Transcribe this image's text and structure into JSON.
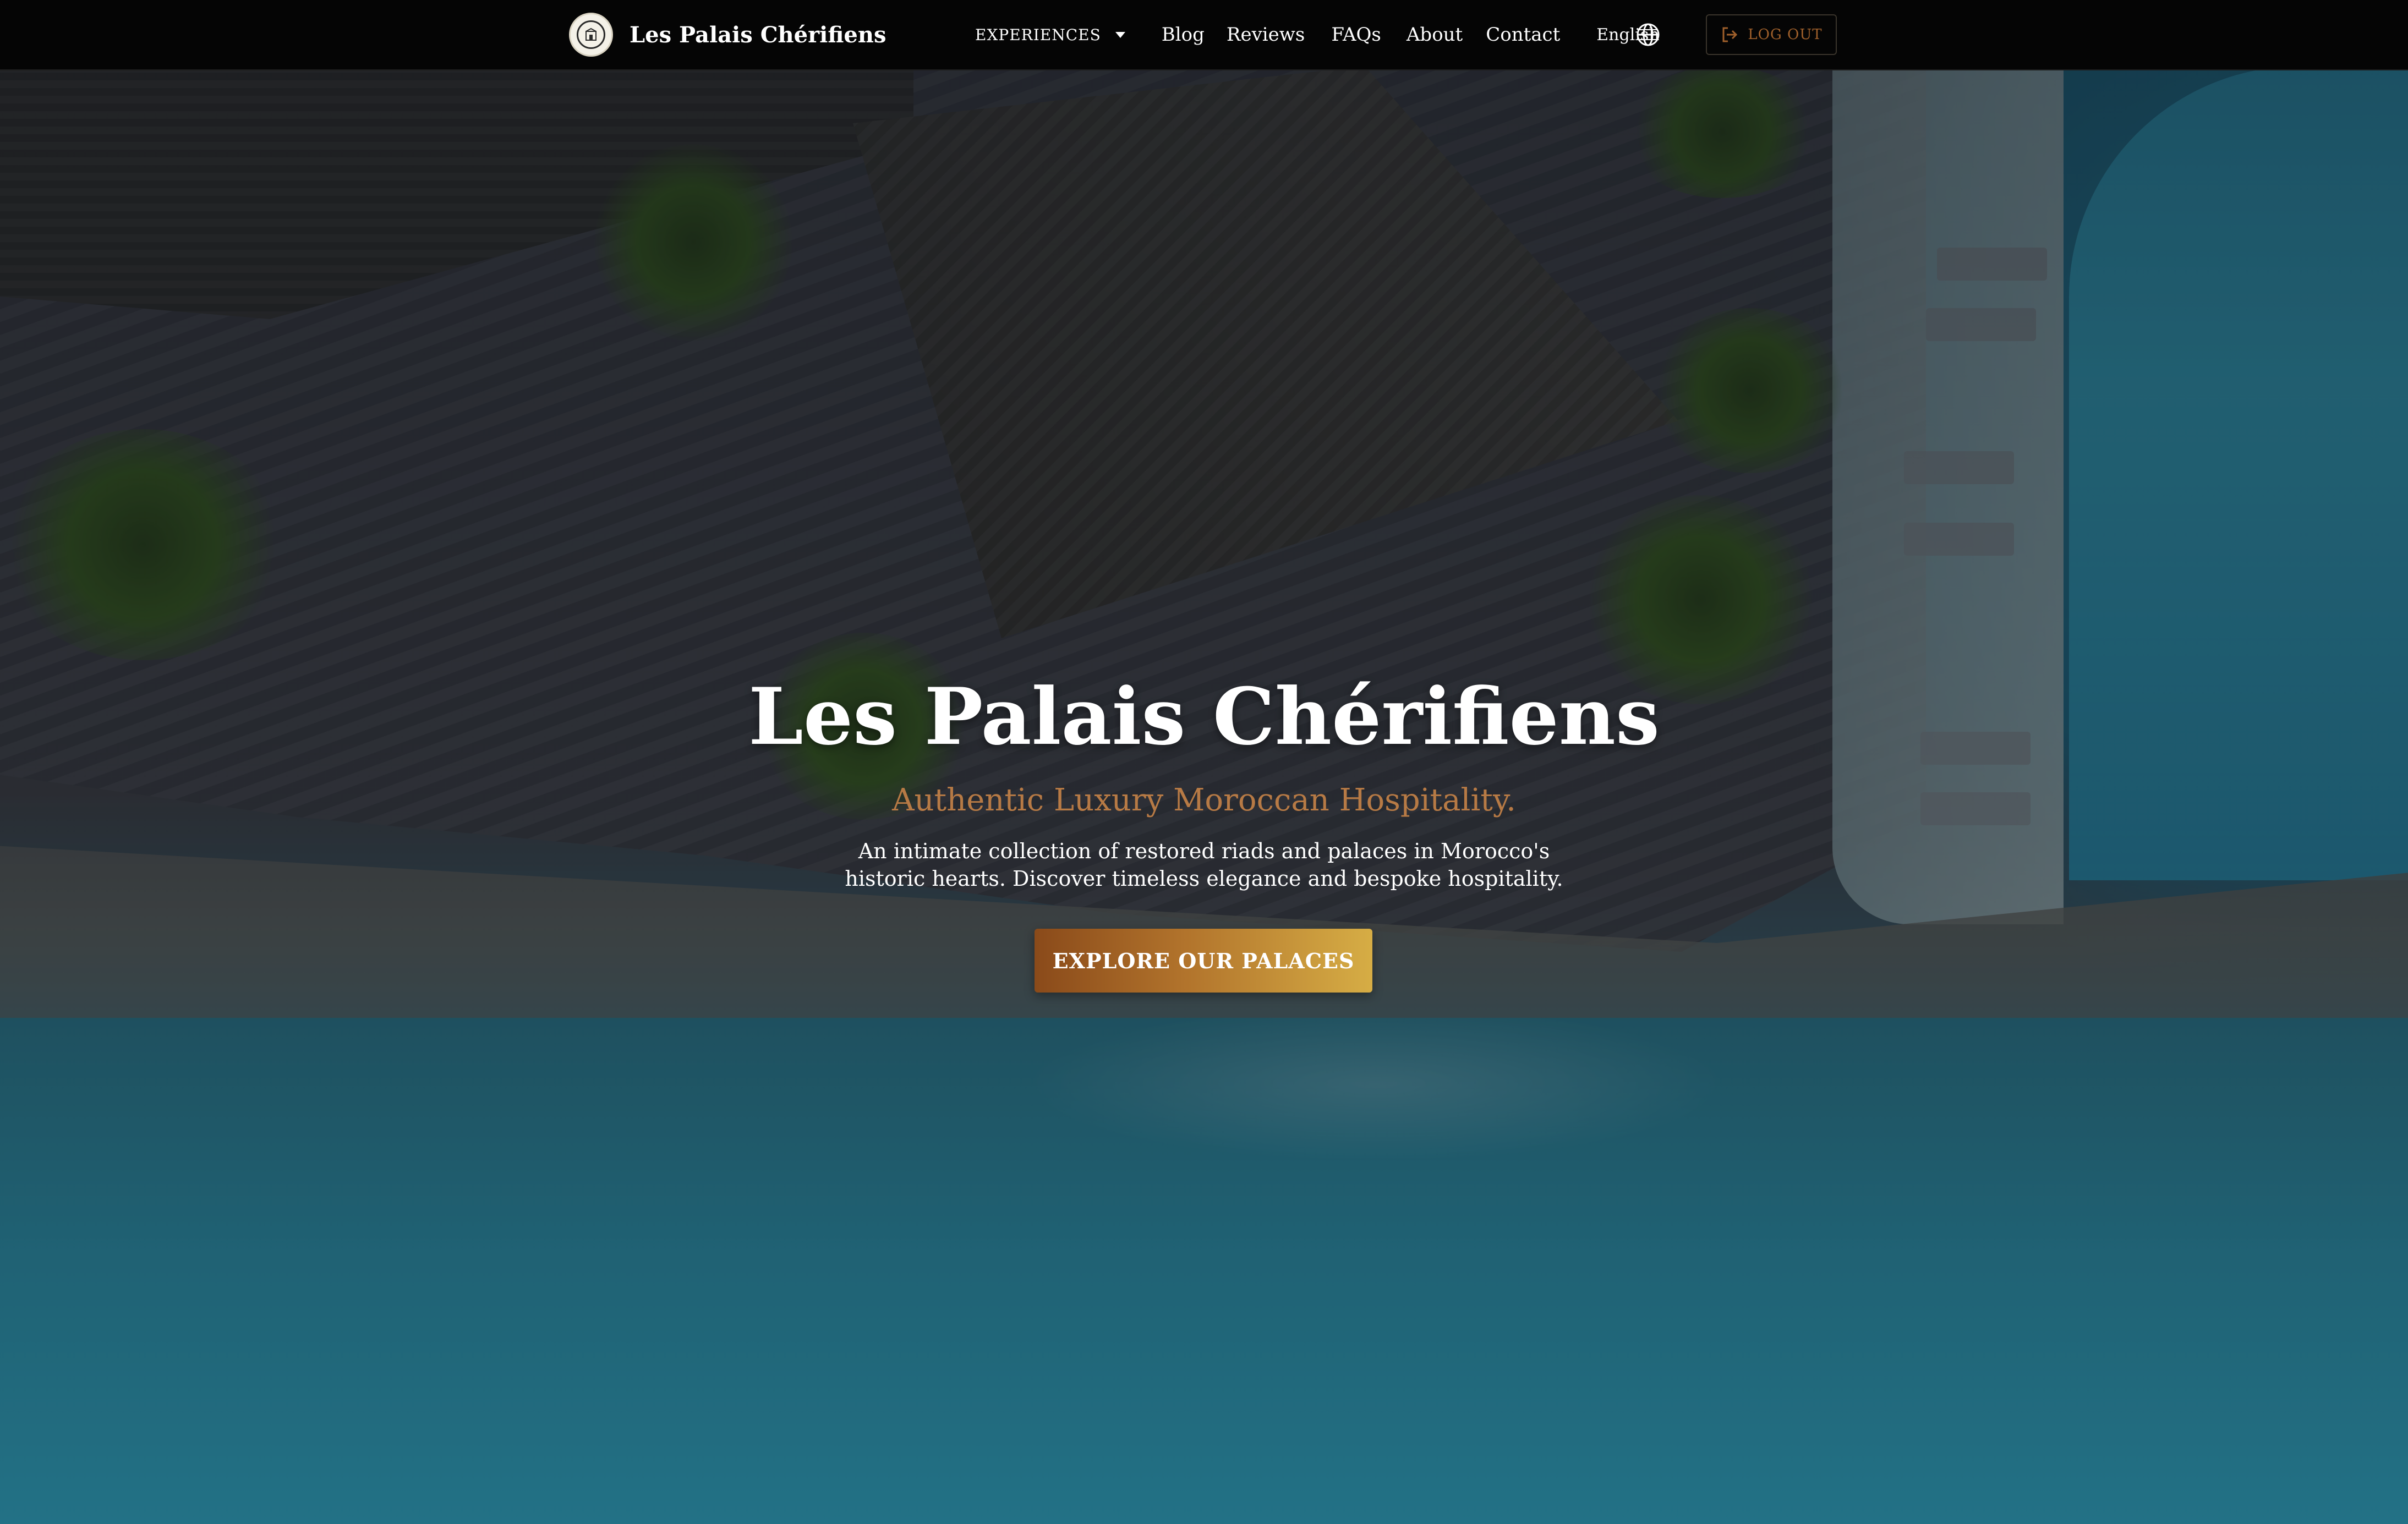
{
  "brand": {
    "name": "Les Palais Chérifiens",
    "logo_icon": "palace-crest-icon"
  },
  "nav": {
    "experiences_label": "EXPERIENCES",
    "links": [
      "Blog",
      "Reviews",
      "FAQs",
      "About",
      "Contact"
    ],
    "language_label": "English",
    "language_icon": "globe-icon",
    "logout_label": "LOG OUT",
    "logout_icon": "logout-icon"
  },
  "hero": {
    "title": "Les Palais Chérifiens",
    "subtitle": "Authentic Luxury Moroccan Hospitality.",
    "description_line1": "An intimate collection of restored riads and palaces in Morocco's",
    "description_line2": "historic hearts. Discover timeless elegance and bespoke hospitality.",
    "cta_label": "EXPLORE OUR PALACES"
  },
  "colors": {
    "navbar_bg": "#050505",
    "accent_bronze": "#b77a45",
    "cta_gradient_start": "#8a4a1a",
    "cta_gradient_end": "#d6ad45",
    "logout_text": "#a0602b"
  }
}
